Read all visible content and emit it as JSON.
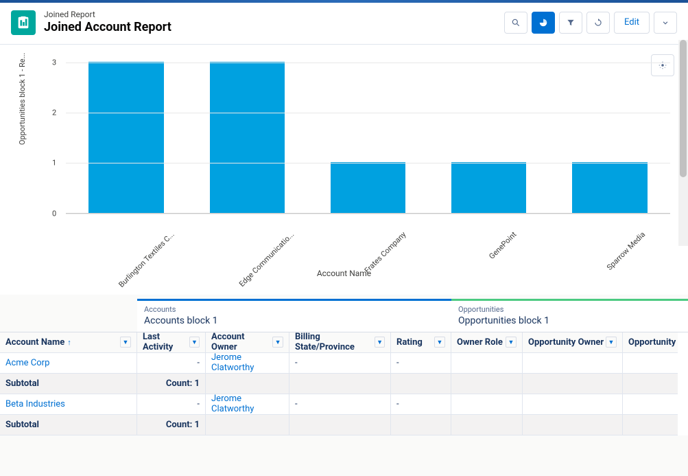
{
  "header": {
    "subtitle": "Joined Report",
    "title": "Joined Account Report",
    "edit_label": "Edit"
  },
  "chart_data": {
    "type": "bar",
    "categories": [
      "Burlington Textiles C...",
      "Edge Communicatio...",
      "Frates Company",
      "GenePoint",
      "Sparrow Media"
    ],
    "values": [
      3,
      3,
      1,
      1,
      1
    ],
    "title": "",
    "xlabel": "Account Name",
    "ylabel": "Opportunities block 1 - Re...",
    "ylim": [
      0,
      3
    ],
    "yticks": [
      0,
      1,
      2,
      3
    ]
  },
  "blocks": {
    "accounts": {
      "type": "Accounts",
      "name": "Accounts block 1"
    },
    "opportunities": {
      "type": "Opportunities",
      "name": "Opportunities block 1"
    }
  },
  "columns": {
    "account_name": "Account Name",
    "last_activity": "Last Activity",
    "account_owner": "Account Owner",
    "billing_state": "Billing State/Province",
    "rating": "Rating",
    "owner_role": "Owner Role",
    "opportunity_owner": "Opportunity Owner",
    "opportunity": "Opportunity"
  },
  "rows": [
    {
      "type": "data",
      "account": "Acme Corp",
      "last": "-",
      "owner": "Jerome Clatworthy",
      "state": "-",
      "rating": "-"
    },
    {
      "type": "subtotal",
      "label": "Subtotal",
      "count_label": "Count: 1"
    },
    {
      "type": "data",
      "account": "Beta Industries",
      "last": "-",
      "owner": "Jerome Clatworthy",
      "state": "-",
      "rating": "-"
    },
    {
      "type": "subtotal",
      "label": "Subtotal",
      "count_label": "Count: 1"
    }
  ]
}
